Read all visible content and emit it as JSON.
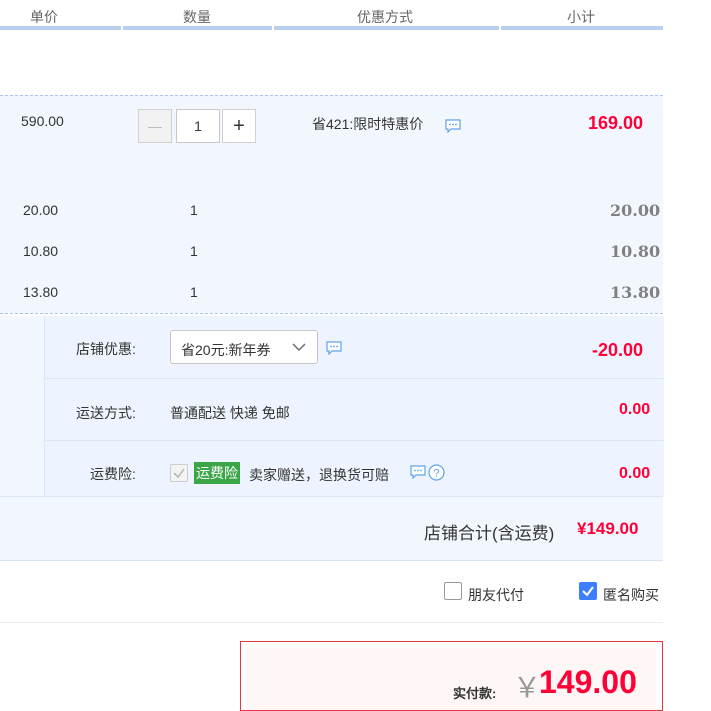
{
  "header": {
    "columns": [
      "单价",
      "数量",
      "优惠方式",
      "小计"
    ]
  },
  "main_item": {
    "price": "590.00",
    "quantity": "1",
    "minus": "—",
    "plus": "+",
    "promo": "省421:限时特惠价",
    "subtotal": "169.00"
  },
  "sub_items": [
    {
      "price": "20.00",
      "quantity": "1",
      "subtotal": "20.00"
    },
    {
      "price": "10.80",
      "quantity": "1",
      "subtotal": "10.80"
    },
    {
      "price": "13.80",
      "quantity": "1",
      "subtotal": "13.80"
    }
  ],
  "store": {
    "discount_label": "店铺优惠:",
    "discount_option": "省20元:新年券",
    "discount_amount": "-20.00",
    "shipping_label": "运送方式:",
    "shipping_value": "普通配送 快递 免邮",
    "shipping_amount": "0.00",
    "insurance_label": "运费险:",
    "insurance_badge": "运费险",
    "insurance_desc": "卖家赠送，退换货可赔",
    "insurance_amount": "0.00",
    "total_label": "店铺合计(含运费)",
    "total_amount": "¥149.00"
  },
  "options": {
    "friend_pay": "朋友代付",
    "anonymous": "匿名购买",
    "anonymous_checked": true
  },
  "payment": {
    "label": "实付款:",
    "currency": "￥",
    "amount": "149.00"
  },
  "colors": {
    "accent_red": "#ff0036",
    "header_blue": "#b8d0ee",
    "checkbox_blue": "#3d7eff",
    "badge_green": "#3aa647"
  }
}
